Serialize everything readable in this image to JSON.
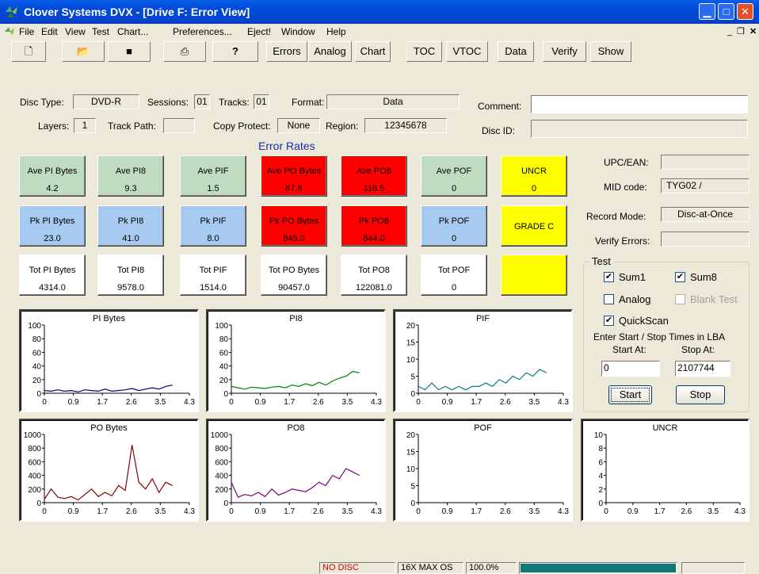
{
  "window": {
    "title": "Clover Systems DVX - [Drive F: Error View]"
  },
  "menu": [
    "File",
    "Edit",
    "View",
    "Test",
    "Chart...",
    "Preferences...",
    "Eject!",
    "Window",
    "Help"
  ],
  "toolbar": {
    "buttons": [
      "Errors",
      "Analog",
      "Chart",
      "TOC",
      "VTOC",
      "Data",
      "Verify",
      "Show"
    ]
  },
  "disc": {
    "disc_type_label": "Disc Type:",
    "disc_type": "DVD-R",
    "sessions_label": "Sessions:",
    "sessions": "01",
    "tracks_label": "Tracks:",
    "tracks": "01",
    "format_label": "Format:",
    "format": "Data",
    "comment_label": "Comment:",
    "comment": "",
    "layers_label": "Layers:",
    "layers": "1",
    "track_path_label": "Track Path:",
    "track_path": "",
    "copy_protect_label": "Copy Protect:",
    "copy_protect": "None",
    "region_label": "Region:",
    "region": "12345678",
    "disc_id_label": "Disc ID:",
    "disc_id": ""
  },
  "error_rates": {
    "title": "Error Rates",
    "ave": [
      {
        "label": "Ave PI Bytes",
        "value": "4.2",
        "color": "#c0dcc0"
      },
      {
        "label": "Ave PI8",
        "value": "9.3",
        "color": "#c0dcc0"
      },
      {
        "label": "Ave PIF",
        "value": "1.5",
        "color": "#c0dcc0"
      },
      {
        "label": "Ave PO Bytes",
        "value": "87.8",
        "color": "#ff0000"
      },
      {
        "label": "Ave PO8",
        "value": "118.5",
        "color": "#ff0000"
      },
      {
        "label": "Ave POF",
        "value": "0",
        "color": "#c0dcc0"
      }
    ],
    "pk": [
      {
        "label": "Pk PI Bytes",
        "value": "23.0",
        "color": "#a6caf0"
      },
      {
        "label": "Pk PI8",
        "value": "41.0",
        "color": "#a6caf0"
      },
      {
        "label": "Pk PIF",
        "value": "8.0",
        "color": "#a6caf0"
      },
      {
        "label": "Pk PO Bytes",
        "value": "845.0",
        "color": "#ff0000"
      },
      {
        "label": "Pk PO8",
        "value": "844.0",
        "color": "#ff0000"
      },
      {
        "label": "Pk POF",
        "value": "0",
        "color": "#a6caf0"
      }
    ],
    "tot": [
      {
        "label": "Tot PI Bytes",
        "value": "4314.0"
      },
      {
        "label": "Tot PI8",
        "value": "9578.0"
      },
      {
        "label": "Tot PIF",
        "value": "1514.0"
      },
      {
        "label": "Tot PO Bytes",
        "value": "90457.0"
      },
      {
        "label": "Tot PO8",
        "value": "122081.0"
      },
      {
        "label": "Tot POF",
        "value": "0"
      }
    ],
    "uncr_label": "UNCR",
    "uncr_value": "0",
    "grade": "GRADE C",
    "yellow": "#ffff00"
  },
  "info": {
    "upc_label": "UPC/EAN:",
    "upc": "",
    "mid_label": "MID code:",
    "mid": "TYG02 /",
    "record_mode_label": "Record Mode:",
    "record_mode": "Disc-at-Once",
    "verify_errors_label": "Verify Errors:",
    "verify_errors": ""
  },
  "test": {
    "group_label": "Test",
    "sum1": "Sum1",
    "sum1_checked": true,
    "sum8": "Sum8",
    "sum8_checked": true,
    "analog": "Analog",
    "analog_checked": false,
    "blank_test": "Blank Test",
    "blank_test_checked": false,
    "quickscan": "QuickScan",
    "quickscan_checked": true,
    "lba_caption": "Enter Start / Stop Times in LBA",
    "start_label": "Start At:",
    "start_value": "0",
    "stop_label": "Stop At:",
    "stop_value": "2107744",
    "start_button": "Start",
    "stop_button": "Stop"
  },
  "chart_data": [
    {
      "type": "line",
      "title": "PI Bytes",
      "color": "#000080",
      "yticks": [
        "100",
        "80",
        "60",
        "40",
        "20",
        "0"
      ],
      "ylim": [
        0,
        100
      ],
      "xticks": [
        "0",
        "0.9",
        "1.7",
        "2.6",
        "3.5",
        "4.3"
      ],
      "xlim": [
        0,
        4.3
      ],
      "x": [
        0,
        0.2,
        0.4,
        0.6,
        0.8,
        1.0,
        1.2,
        1.4,
        1.6,
        1.8,
        2.0,
        2.2,
        2.4,
        2.6,
        2.8,
        3.0,
        3.2,
        3.4,
        3.6,
        3.8
      ],
      "y": [
        4,
        3,
        5,
        3,
        4,
        2,
        5,
        4,
        3,
        6,
        3,
        4,
        5,
        7,
        4,
        6,
        8,
        6,
        10,
        12
      ]
    },
    {
      "type": "line",
      "title": "PI8",
      "color": "#008000",
      "yticks": [
        "100",
        "80",
        "60",
        "40",
        "20",
        "0"
      ],
      "ylim": [
        0,
        100
      ],
      "xticks": [
        "0",
        "0.9",
        "1.7",
        "2.6",
        "3.5",
        "4.3"
      ],
      "xlim": [
        0,
        4.3
      ],
      "x": [
        0,
        0.2,
        0.4,
        0.6,
        0.8,
        1.0,
        1.2,
        1.4,
        1.6,
        1.8,
        2.0,
        2.2,
        2.4,
        2.6,
        2.8,
        3.0,
        3.2,
        3.4,
        3.6,
        3.8
      ],
      "y": [
        10,
        8,
        6,
        9,
        8,
        7,
        9,
        10,
        8,
        12,
        10,
        14,
        11,
        16,
        12,
        18,
        22,
        25,
        32,
        30
      ]
    },
    {
      "type": "line",
      "title": "PIF",
      "color": "#008080",
      "yticks": [
        "20",
        "15",
        "10",
        "5",
        "0"
      ],
      "ylim": [
        0,
        20
      ],
      "xticks": [
        "0",
        "0.9",
        "1.7",
        "2.6",
        "3.5",
        "4.3"
      ],
      "xlim": [
        0,
        4.3
      ],
      "x": [
        0,
        0.2,
        0.4,
        0.6,
        0.8,
        1.0,
        1.2,
        1.4,
        1.6,
        1.8,
        2.0,
        2.2,
        2.4,
        2.6,
        2.8,
        3.0,
        3.2,
        3.4,
        3.6,
        3.8
      ],
      "y": [
        2,
        1,
        3,
        1,
        2,
        1,
        2,
        1,
        2,
        2,
        3,
        2,
        4,
        3,
        5,
        4,
        6,
        5,
        7,
        6
      ]
    },
    {
      "type": "line",
      "title": "PO Bytes",
      "color": "#800000",
      "yticks": [
        "1000",
        "800",
        "600",
        "400",
        "200",
        "0"
      ],
      "ylim": [
        0,
        1000
      ],
      "xticks": [
        "0",
        "0.9",
        "1.7",
        "2.6",
        "3.5",
        "4.3"
      ],
      "xlim": [
        0,
        4.3
      ],
      "x": [
        0,
        0.2,
        0.4,
        0.6,
        0.8,
        1.0,
        1.2,
        1.4,
        1.6,
        1.8,
        2.0,
        2.2,
        2.4,
        2.6,
        2.8,
        3.0,
        3.2,
        3.4,
        3.6,
        3.8
      ],
      "y": [
        50,
        200,
        80,
        60,
        90,
        40,
        120,
        200,
        90,
        150,
        100,
        250,
        180,
        845,
        300,
        200,
        350,
        150,
        300,
        250
      ]
    },
    {
      "type": "line",
      "title": "PO8",
      "color": "#800080",
      "yticks": [
        "1000",
        "800",
        "600",
        "400",
        "200",
        "0"
      ],
      "ylim": [
        0,
        1000
      ],
      "xticks": [
        "0",
        "0.9",
        "1.7",
        "2.6",
        "3.5",
        "4.3"
      ],
      "xlim": [
        0,
        4.3
      ],
      "x": [
        0,
        0.2,
        0.4,
        0.6,
        0.8,
        1.0,
        1.2,
        1.4,
        1.6,
        1.8,
        2.0,
        2.2,
        2.4,
        2.6,
        2.8,
        3.0,
        3.2,
        3.4,
        3.6,
        3.8
      ],
      "y": [
        300,
        80,
        120,
        100,
        150,
        90,
        200,
        110,
        150,
        200,
        180,
        160,
        220,
        300,
        250,
        400,
        350,
        500,
        450,
        400
      ]
    },
    {
      "type": "line",
      "title": "POF",
      "color": "#000000",
      "yticks": [
        "20",
        "15",
        "10",
        "5",
        "0"
      ],
      "ylim": [
        0,
        20
      ],
      "xticks": [
        "0",
        "0.9",
        "1.7",
        "2.6",
        "3.5",
        "4.3"
      ],
      "xlim": [
        0,
        4.3
      ],
      "x": [],
      "y": []
    },
    {
      "type": "line",
      "title": "UNCR",
      "color": "#000000",
      "yticks": [
        "10",
        "8",
        "6",
        "4",
        "2",
        "0"
      ],
      "ylim": [
        0,
        10
      ],
      "xticks": [
        "0",
        "0.9",
        "1.7",
        "2.6",
        "3.5",
        "4.3"
      ],
      "xlim": [
        0,
        4.3
      ],
      "x": [],
      "y": []
    }
  ],
  "status": {
    "no_disc": "NO DISC",
    "speed": "16X MAX OS",
    "percent": "100.0%",
    "progress": 1.0
  }
}
